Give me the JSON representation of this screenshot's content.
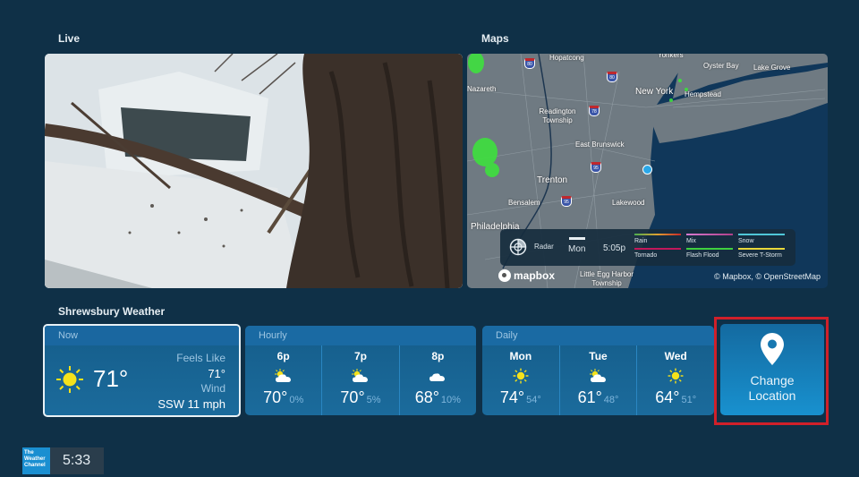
{
  "sections": {
    "live_title": "Live",
    "maps_title": "Maps",
    "weather_title": "Shrewsbury Weather"
  },
  "map": {
    "labels": [
      {
        "text": "Hopatcong",
        "size": "small"
      },
      {
        "text": "Yonkers",
        "size": "small"
      },
      {
        "text": "Oyster Bay",
        "size": "small"
      },
      {
        "text": "Lake Grove",
        "size": "small"
      },
      {
        "text": "Nazareth",
        "size": "small"
      },
      {
        "text": "New York",
        "size": "big"
      },
      {
        "text": "Hempstead",
        "size": "small"
      },
      {
        "text": "Readington Township",
        "size": "small"
      },
      {
        "text": "East Brunswick",
        "size": "small"
      },
      {
        "text": "Trenton",
        "size": "big"
      },
      {
        "text": "Bensalem",
        "size": "small"
      },
      {
        "text": "Lakewood",
        "size": "small"
      },
      {
        "text": "Philadelphia",
        "size": "big"
      },
      {
        "text": "Little Egg Harbor Township",
        "size": "small"
      }
    ],
    "highways": [
      "80",
      "80",
      "78",
      "95",
      "95"
    ],
    "radar": {
      "label": "Radar",
      "day": "Mon",
      "time": "5:05p"
    },
    "legend": [
      {
        "label": "Rain",
        "color": "#4caf50",
        "color2": "#c62828"
      },
      {
        "label": "Mix",
        "color": "#d77ad0",
        "color2": "#b0408a"
      },
      {
        "label": "Snow",
        "color": "#4fc7d8",
        "color2": "#4fc7d8"
      },
      {
        "label": "Tornado",
        "color": "#c2185b",
        "color2": "#c2185b"
      },
      {
        "label": "Flash Flood",
        "color": "#3fcf3f",
        "color2": "#3fcf3f"
      },
      {
        "label": "Severe T-Storm",
        "color": "#e8d83a",
        "color2": "#e8d83a"
      }
    ],
    "logo": "mapbox",
    "attribution": "© Mapbox, © OpenStreetMap"
  },
  "now": {
    "header": "Now",
    "icon": "sunny-icon",
    "temp": "71°",
    "feels_like_label": "Feels Like",
    "feels_like_value": "71°",
    "wind_label": "Wind",
    "wind_value": "SSW 11 mph"
  },
  "hourly": {
    "header": "Hourly",
    "items": [
      {
        "label": "6p",
        "icon": "partly-cloudy-icon",
        "temp": "70°",
        "sub": "0%"
      },
      {
        "label": "7p",
        "icon": "partly-cloudy-icon",
        "temp": "70°",
        "sub": "5%"
      },
      {
        "label": "8p",
        "icon": "cloudy-icon",
        "temp": "68°",
        "sub": "10%"
      }
    ]
  },
  "daily": {
    "header": "Daily",
    "items": [
      {
        "label": "Mon",
        "icon": "sunny-icon",
        "temp": "74°",
        "sub": "54°"
      },
      {
        "label": "Tue",
        "icon": "partly-cloudy-icon",
        "temp": "61°",
        "sub": "48°"
      },
      {
        "label": "Wed",
        "icon": "sunny-icon",
        "temp": "64°",
        "sub": "51°"
      }
    ]
  },
  "change_location": {
    "line1": "Change",
    "line2": "Location"
  },
  "footer": {
    "logo_line1": "The",
    "logo_line2": "Weather",
    "logo_line3": "Channel",
    "time": "5:33"
  },
  "colors": {
    "background": "#0f3047",
    "card": "#1b6b9c",
    "accent": "#1891cf",
    "highlight_outline": "#d0202a",
    "sun": "#f5e21b"
  }
}
